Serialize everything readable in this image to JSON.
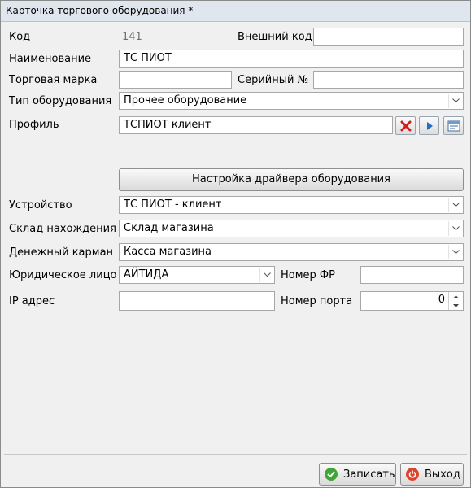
{
  "window": {
    "title": "Карточка торгового оборудования *"
  },
  "form": {
    "code": {
      "label": "Код",
      "value": "141"
    },
    "external_code": {
      "label": "Внешний код",
      "value": ""
    },
    "name": {
      "label": "Наименование",
      "value": "ТС ПИОТ"
    },
    "trademark": {
      "label": "Торговая марка",
      "value": ""
    },
    "serial": {
      "label": "Серийный №",
      "value": ""
    },
    "equipment_type": {
      "label": "Тип оборудования",
      "value": "Прочее оборудование"
    },
    "profile": {
      "label": "Профиль",
      "value": "ТСПИОТ клиент"
    },
    "driver_button": "Настройка драйвера оборудования",
    "device": {
      "label": "Устройство",
      "value": "ТС ПИОТ - клиент"
    },
    "warehouse": {
      "label": "Склад нахождения",
      "value": "Склад магазина"
    },
    "cash_pocket": {
      "label": "Денежный карман",
      "value": "Касса магазина"
    },
    "legal_entity": {
      "label": "Юридическое лицо",
      "value": "АЙТИДА"
    },
    "fr_number": {
      "label": "Номер ФР",
      "value": ""
    },
    "ip": {
      "label": "IP адрес",
      "value": ""
    },
    "port": {
      "label": "Номер порта",
      "value": "0"
    }
  },
  "footer": {
    "save_label": "Записать",
    "exit_label": "Выход"
  },
  "colors": {
    "save_icon": "#3fa535",
    "exit_icon": "#e0432b",
    "clear_icon": "#d21d1d",
    "play_icon": "#1f6fc4"
  }
}
